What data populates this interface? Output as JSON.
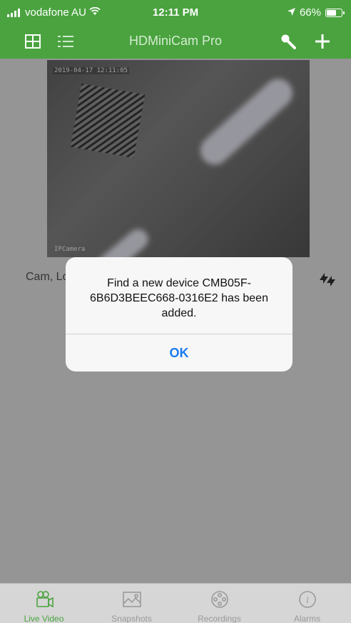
{
  "status_bar": {
    "carrier": "vodafone AU",
    "time": "12:11 PM",
    "battery": "66%",
    "battery_level": 0.66
  },
  "navbar": {
    "title": "HDMiniCam Pro"
  },
  "camera": {
    "osd_datetime": "2019-04-17 12:11:05",
    "osd_name": "IPCamera",
    "row_label": "Cam, Lo"
  },
  "alert": {
    "message": "Find a new device CMB05F-6B6D3BEEC668-0316E2 has been added.",
    "ok_label": "OK"
  },
  "tabs": [
    {
      "label": "Live Video",
      "icon": "video-camera-icon",
      "active": true
    },
    {
      "label": "Snapshots",
      "icon": "image-icon",
      "active": false
    },
    {
      "label": "Recordings",
      "icon": "film-reel-icon",
      "active": false
    },
    {
      "label": "Alarms",
      "icon": "info-icon",
      "active": false
    }
  ],
  "colors": {
    "brand_green": "#4aa33f",
    "ios_blue": "#1a7bf0",
    "tab_inactive": "#9a9a9a"
  }
}
